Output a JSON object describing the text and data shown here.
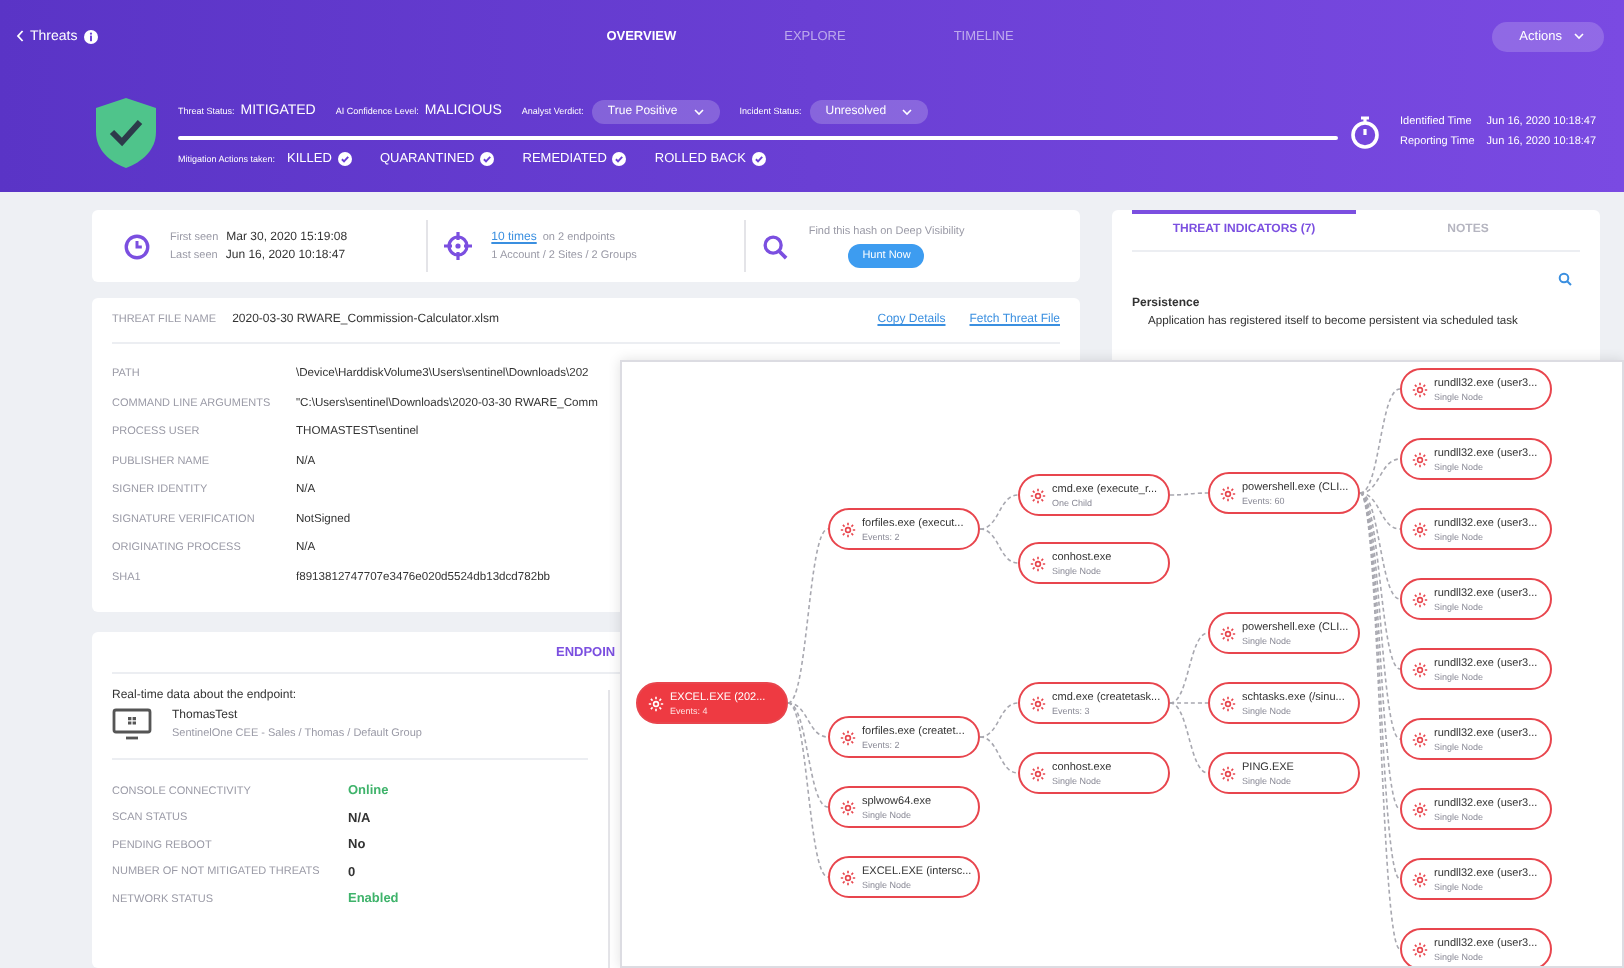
{
  "top_bar": {
    "back": "Threats",
    "tabs": [
      {
        "label": "OVERVIEW",
        "selected": true
      },
      {
        "label": "EXPLORE",
        "selected": false
      },
      {
        "label": "TIMELINE",
        "selected": false
      }
    ],
    "actions": "Actions"
  },
  "status": {
    "fields": [
      {
        "kind": "text",
        "label": "Threat Status:",
        "value": "MITIGATED"
      },
      {
        "kind": "text",
        "label": "AI Confidence Level:",
        "value": "MALICIOUS"
      },
      {
        "kind": "dropdown",
        "label": "Analyst Verdict:",
        "value": "True Positive"
      },
      {
        "kind": "dropdown",
        "label": "Incident Status:",
        "value": "Unresolved"
      }
    ],
    "mitigation_label": "Mitigation Actions taken:",
    "actions": [
      {
        "label": "KILLED",
        "done": true
      },
      {
        "label": "QUARANTINED",
        "done": true
      },
      {
        "label": "REMEDIATED",
        "done": true
      },
      {
        "label": "ROLLED BACK",
        "done": true
      }
    ],
    "times": [
      {
        "label": "Identified Time",
        "value": "Jun 16, 2020 10:18:47"
      },
      {
        "label": "Reporting Time",
        "value": "Jun 16, 2020 10:18:47"
      }
    ]
  },
  "summary": {
    "first_seen_label": "First seen",
    "first_seen": "Mar 30, 2020 15:19:08",
    "last_seen_label": "Last seen",
    "last_seen": "Jun 16, 2020 10:18:47",
    "times_link": "10 times",
    "endpoints": "on 2 endpoints",
    "scope": "1 Account / 2 Sites / 2 Groups",
    "hunt_hint": "Find this hash on Deep Visibility",
    "hunt_button": "Hunt Now"
  },
  "file_details": {
    "name_label": "THREAT FILE NAME",
    "name": "2020-03-30 RWARE_Commission-Calculator.xlsm",
    "links": [
      "Copy Details",
      "Fetch Threat File"
    ],
    "rows": [
      {
        "label": "PATH",
        "value": "\\Device\\HarddiskVolume3\\Users\\sentinel\\Downloads\\202"
      },
      {
        "label": "COMMAND LINE ARGUMENTS",
        "value": "\"C:\\Users\\sentinel\\Downloads\\2020-03-30 RWARE_Comm"
      },
      {
        "label": "PROCESS USER",
        "value": "THOMASTEST\\sentinel"
      },
      {
        "label": "PUBLISHER NAME",
        "value": "N/A"
      },
      {
        "label": "SIGNER IDENTITY",
        "value": "N/A"
      },
      {
        "label": "SIGNATURE VERIFICATION",
        "value": "NotSigned"
      },
      {
        "label": "ORIGINATING PROCESS",
        "value": "N/A"
      },
      {
        "label": "SHA1",
        "value": "f8913812747707e3476e020d5524db13dcd782bb"
      }
    ]
  },
  "endpoint": {
    "tab": "ENDPOIN",
    "intro": "Real-time data about the endpoint:",
    "name": "ThomasTest",
    "group": "SentinelOne CEE - Sales / Thomas / Default Group",
    "rows": [
      {
        "label": "CONSOLE CONNECTIVITY",
        "value": "Online",
        "color": "#3fb36b"
      },
      {
        "label": "SCAN STATUS",
        "value": "N/A",
        "color": "#333333"
      },
      {
        "label": "PENDING REBOOT",
        "value": "No",
        "color": "#333333"
      },
      {
        "label": "NUMBER OF NOT MITIGATED THREATS",
        "value": "0",
        "color": "#333333"
      },
      {
        "label": "NETWORK STATUS",
        "value": "Enabled",
        "color": "#3fb36b"
      }
    ]
  },
  "indicators": {
    "tabs": [
      {
        "label": "THREAT INDICATORS (7)",
        "selected": true
      },
      {
        "label": "NOTES",
        "selected": false
      }
    ],
    "section": "Persistence",
    "text": "Application has registered itself to become persistent via scheduled task"
  },
  "graph": {
    "root": {
      "name": "EXCEL.EXE (202...",
      "detail": "Events: 4",
      "selected": true,
      "children": [
        {
          "name": "forfiles.exe (execut...",
          "detail": "Events: 2",
          "selected": false,
          "children": [
            {
              "name": "cmd.exe (execute_r...",
              "detail": "One Child",
              "selected": false,
              "children": [
                {
                  "name": "powershell.exe (CLI...",
                  "detail": "Events: 60",
                  "selected": false,
                  "children": [
                    {
                      "name": "rundll32.exe (user3...",
                      "detail": "Single Node",
                      "selected": false
                    },
                    {
                      "name": "rundll32.exe (user3...",
                      "detail": "Single Node",
                      "selected": false
                    },
                    {
                      "name": "rundll32.exe (user3...",
                      "detail": "Single Node",
                      "selected": false
                    },
                    {
                      "name": "rundll32.exe (user3...",
                      "detail": "Single Node",
                      "selected": false
                    },
                    {
                      "name": "rundll32.exe (user3...",
                      "detail": "Single Node",
                      "selected": false
                    },
                    {
                      "name": "rundll32.exe (user3...",
                      "detail": "Single Node",
                      "selected": false
                    },
                    {
                      "name": "rundll32.exe (user3...",
                      "detail": "Single Node",
                      "selected": false
                    },
                    {
                      "name": "rundll32.exe (user3...",
                      "detail": "Single Node",
                      "selected": false
                    },
                    {
                      "name": "rundll32.exe (user3...",
                      "detail": "Single Node",
                      "selected": false
                    }
                  ]
                }
              ]
            },
            {
              "name": "conhost.exe",
              "detail": "Single Node",
              "selected": false
            }
          ]
        },
        {
          "name": "forfiles.exe (createt...",
          "detail": "Events: 2",
          "selected": false,
          "children": [
            {
              "name": "cmd.exe (createtask...",
              "detail": "Events: 3",
              "selected": false,
              "children": [
                {
                  "name": "powershell.exe (CLI...",
                  "detail": "Single Node",
                  "selected": false
                },
                {
                  "name": "schtasks.exe (/sinu...",
                  "detail": "Single Node",
                  "selected": false
                },
                {
                  "name": "PING.EXE",
                  "detail": "Single Node",
                  "selected": false
                }
              ]
            },
            {
              "name": "conhost.exe",
              "detail": "Single Node",
              "selected": false
            }
          ]
        },
        {
          "name": "splwow64.exe",
          "detail": "Single Node",
          "selected": false
        },
        {
          "name": "EXCEL.EXE (intersc...",
          "detail": "Single Node",
          "selected": false
        }
      ]
    }
  }
}
